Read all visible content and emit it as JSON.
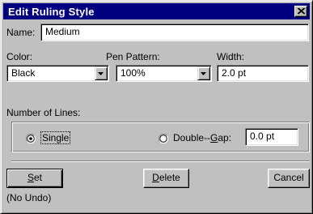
{
  "window": {
    "title": "Edit Ruling Style",
    "close_icon": "close-icon"
  },
  "name": {
    "label": "Name:",
    "value": "Medium"
  },
  "color": {
    "label": "Color:",
    "value": "Black"
  },
  "pen_pattern": {
    "label": "Pen Pattern:",
    "value": "100%"
  },
  "width": {
    "label": "Width:",
    "value": "2.0 pt"
  },
  "lines": {
    "label": "Number of Lines:",
    "single_label": "Single",
    "single_selected": true,
    "double_label_prefix": "Double--",
    "double_mnemonic": "G",
    "double_label_suffix": "ap:",
    "double_selected": false,
    "gap_value": "0.0 pt"
  },
  "buttons": {
    "set_mnemonic": "S",
    "set_rest": "et",
    "delete_mnemonic": "D",
    "delete_rest": "elete",
    "cancel": "Cancel"
  },
  "status": {
    "undo_text": "(No Undo)"
  },
  "colors": {
    "titlebar": "#000080",
    "face": "#c0c0c0"
  }
}
